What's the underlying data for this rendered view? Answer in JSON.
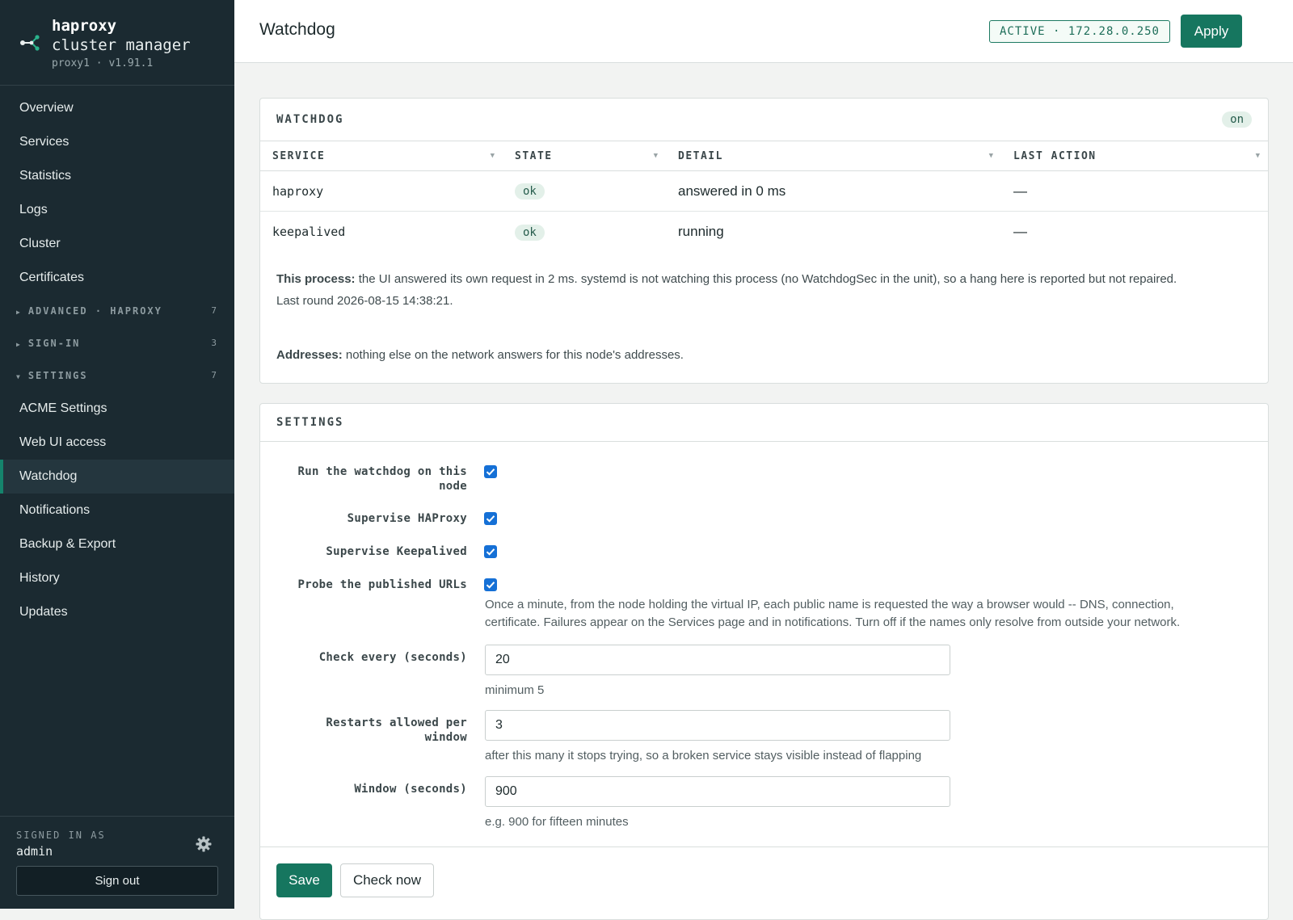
{
  "brand": {
    "name": "haproxy",
    "subtitle": "cluster manager",
    "node": "proxy1 · v1.91.1"
  },
  "nav": {
    "top": [
      "Overview",
      "Services",
      "Statistics",
      "Logs",
      "Cluster",
      "Certificates"
    ],
    "groups": [
      {
        "label": "ADVANCED · HAPROXY",
        "count": "7",
        "expanded": false
      },
      {
        "label": "SIGN-IN",
        "count": "3",
        "expanded": false
      },
      {
        "label": "SETTINGS",
        "count": "7",
        "expanded": true
      }
    ],
    "settings_items": [
      "ACME Settings",
      "Web UI access",
      "Watchdog",
      "Notifications",
      "Backup & Export",
      "History",
      "Updates"
    ],
    "active": "Watchdog"
  },
  "footer": {
    "signed_in_label": "SIGNED IN AS",
    "user": "admin",
    "sign_out": "Sign out"
  },
  "header": {
    "title": "Watchdog",
    "status": "ACTIVE · 172.28.0.250",
    "apply": "Apply"
  },
  "watchdog": {
    "title": "WATCHDOG",
    "status_pill": "on",
    "columns": [
      "SERVICE",
      "STATE",
      "DETAIL",
      "LAST ACTION"
    ],
    "rows": [
      {
        "service": "haproxy",
        "state": "ok",
        "detail": "answered in 0 ms",
        "last_action": "—"
      },
      {
        "service": "keepalived",
        "state": "ok",
        "detail": "running",
        "last_action": "—"
      }
    ],
    "process_label": "This process:",
    "process_text": "the UI answered its own request in 2 ms. systemd is not watching this process (no WatchdogSec in the unit), so a hang here is reported but not repaired.",
    "last_round": "Last round 2026-08-15 14:38:21.",
    "addresses_label": "Addresses:",
    "addresses_text": "nothing else on the network answers for this node's addresses."
  },
  "settings": {
    "title": "SETTINGS",
    "run_label_1": "Run the watchdog on this",
    "run_label_2": "node",
    "run_checked": true,
    "haproxy_label": "Supervise HAProxy",
    "haproxy_checked": true,
    "keepalived_label": "Supervise Keepalived",
    "keepalived_checked": true,
    "probe_label": "Probe the published URLs",
    "probe_checked": true,
    "probe_help_1": "Once a minute, from the node holding the virtual IP, each public name is requested the way a browser would -- DNS, connection,",
    "probe_help_2": "certificate. Failures appear on the Services page and in notifications. Turn off if the names only resolve from outside your network.",
    "check_label": "Check every (seconds)",
    "check_value": "20",
    "check_help": "minimum 5",
    "restarts_label_1": "Restarts allowed per",
    "restarts_label_2": "window",
    "restarts_value": "3",
    "restarts_help": "after this many it stops trying, so a broken service stays visible instead of flapping",
    "window_label": "Window (seconds)",
    "window_value": "900",
    "window_help": "e.g. 900 for fifteen minutes",
    "save": "Save",
    "check_now": "Check now"
  },
  "colors": {
    "accent": "#16765f",
    "sidebar_bg": "#1b2a31",
    "checkbox": "#1570d6"
  }
}
